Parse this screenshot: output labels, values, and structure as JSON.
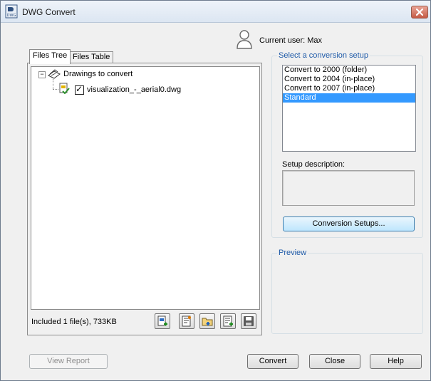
{
  "window": {
    "title": "DWG Convert",
    "app_icon_text": "DWG"
  },
  "user": {
    "label": "Current user: Max"
  },
  "tabs": [
    {
      "label": "Files Tree",
      "active": true
    },
    {
      "label": "Files Table",
      "active": false
    }
  ],
  "tree": {
    "root": {
      "label": "Drawings to convert",
      "expander": "−"
    },
    "children": [
      {
        "label": "visualization_-_aerial0.dwg",
        "checked": true,
        "check_glyph": "✓"
      }
    ]
  },
  "status": {
    "text": "Included 1 file(s), 733KB"
  },
  "toolbar": {
    "icons": [
      "add-file-icon",
      "add-sheet-list-icon",
      "add-folder-icon",
      "append-list-icon",
      "save-list-icon"
    ]
  },
  "conversion_setup": {
    "group_title": "Select a conversion setup",
    "items": [
      "Convert to 2000 (folder)",
      "Convert to 2004 (in-place)",
      "Convert to 2007 (in-place)",
      "Standard"
    ],
    "selected_index": 3,
    "description_label": "Setup description:",
    "setups_button": "Conversion Setups..."
  },
  "preview": {
    "group_title": "Preview"
  },
  "buttons": {
    "view_report": "View Report",
    "convert": "Convert",
    "close": "Close",
    "help": "Help"
  },
  "colors": {
    "accent_blue": "#1e5aa8",
    "selection": "#3399ff",
    "close_red": "#c55b45"
  }
}
